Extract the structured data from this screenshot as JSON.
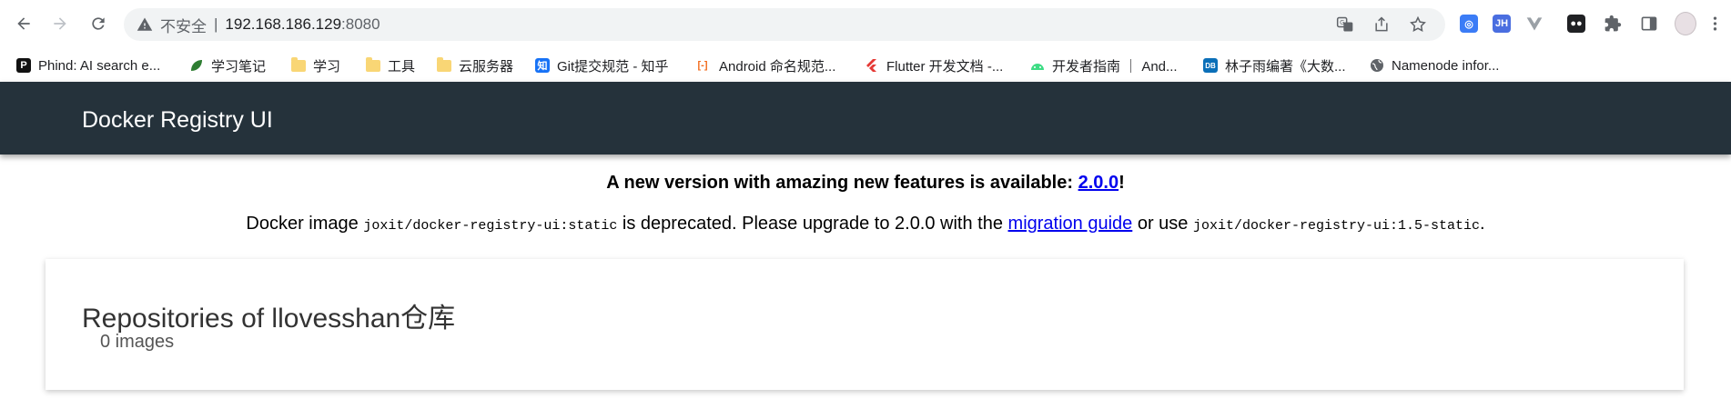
{
  "browser": {
    "insecure_label": "不安全",
    "separator": "|",
    "url_host": "192.168.186.129",
    "url_port": ":8080",
    "icons": [
      "back-icon",
      "forward-icon",
      "reload-icon",
      "warning-icon",
      "translate-icon",
      "share-icon",
      "star-icon",
      "extension-icons",
      "puzzle-icon",
      "sidepanel-icon",
      "profile-avatar",
      "menu-icon"
    ],
    "extension_jh_label": "JH"
  },
  "bookmarks": [
    {
      "label": "Phind: AI search e...",
      "icon": "phind-icon",
      "icon_text": "P"
    },
    {
      "label": "学习笔记",
      "icon": "leaf-icon",
      "icon_text": ""
    },
    {
      "label": "学习",
      "icon": "folder-icon"
    },
    {
      "label": "工具",
      "icon": "folder-icon"
    },
    {
      "label": "云服务器",
      "icon": "folder-icon"
    },
    {
      "label": "Git提交规范 - 知乎",
      "icon": "zhihu-icon",
      "icon_text": "知"
    },
    {
      "label": "Android 命名规范...",
      "icon": "bracket-icon",
      "icon_text": "[-]"
    },
    {
      "label": "Flutter 开发文档 -...",
      "icon": "flutter-icon"
    },
    {
      "label": "开发者指南 ｜ And...",
      "icon": "android-icon"
    },
    {
      "label": "林子雨编著《大数...",
      "icon": "dblab-icon",
      "icon_text": "DB"
    },
    {
      "label": "Namenode infor...",
      "icon": "globe-icon"
    }
  ],
  "app": {
    "title": "Docker Registry UI",
    "header_color": "#25323b"
  },
  "notice": {
    "line1_text": "A new version with amazing new features is available: ",
    "line1_link": "2.0.0",
    "line1_end": "!",
    "line2_a": "Docker image ",
    "line2_code1": "joxit/docker-registry-ui:static",
    "line2_b": " is deprecated. Please upgrade to 2.0.0 with the ",
    "line2_link": "migration guide",
    "line2_c": " or use ",
    "line2_code2": "joxit/docker-registry-ui:1.5-static",
    "line2_end": "."
  },
  "repositories": {
    "title": "Repositories of llovesshan仓库",
    "count": "0 images"
  }
}
